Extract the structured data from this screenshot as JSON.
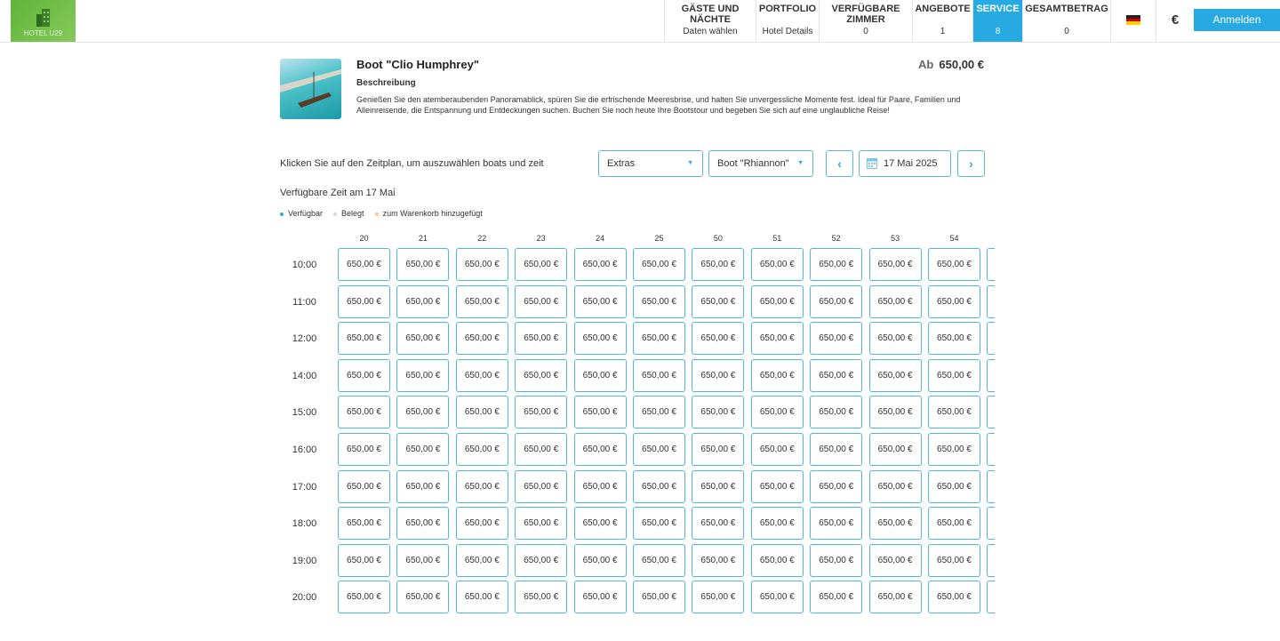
{
  "header": {
    "logo_text": "HOTEL U29",
    "nav": [
      {
        "title": "GÄSTE UND NÄCHTE",
        "sub": "Daten wählen"
      },
      {
        "title": "PORTFOLIO",
        "sub": "Hotel Details"
      },
      {
        "title": "VERFÜGBARE ZIMMER",
        "sub": "0"
      },
      {
        "title": "ANGEBOTE",
        "sub": "1"
      },
      {
        "title": "SERVICE",
        "sub": "8",
        "active": true
      },
      {
        "title": "GESAMTBETRAG",
        "sub": "0"
      }
    ],
    "language_icon": "german-flag-icon",
    "currency": "€",
    "login_label": "Anmelden"
  },
  "product": {
    "title": "Boot \"Clio Humphrey\"",
    "price_prefix": "Ab",
    "price": "650,00 €",
    "desc_heading": "Beschreibung",
    "description": "Genießen Sie den atemberaubenden Panoramablick, spüren Sie die erfrischende Meeresbrise, und halten Sie unvergessliche Momente fest. Ideal für Paare, Familien und Alleinreisende, die Entspannung und Entdeckungen suchen. Buchen Sie noch heute Ihre Bootstour und begeben Sie sich auf eine unglaubliche Reise!"
  },
  "controls": {
    "instruction": "Klicken Sie auf den Zeitplan, um auszuwählen boats und zeit",
    "extras": "Extras",
    "boat": "Boot \"Rhiannon\"",
    "date": "17 Mai 2025"
  },
  "schedule": {
    "title": "Verfügbare Zeit am 17 Mai",
    "legend": [
      {
        "label": "Verfügbar",
        "color": "#27a9e1"
      },
      {
        "label": "Belegt",
        "color": "#d5d8de"
      },
      {
        "label": "zum Warenkorb hinzugefügt",
        "color": "#f6c98f"
      }
    ],
    "columns": [
      "20",
      "21",
      "22",
      "23",
      "24",
      "25",
      "50",
      "51",
      "52",
      "53",
      "54"
    ],
    "times": [
      "10:00",
      "11:00",
      "12:00",
      "14:00",
      "15:00",
      "16:00",
      "17:00",
      "18:00",
      "19:00",
      "20:00"
    ],
    "price": "650,00 €"
  }
}
